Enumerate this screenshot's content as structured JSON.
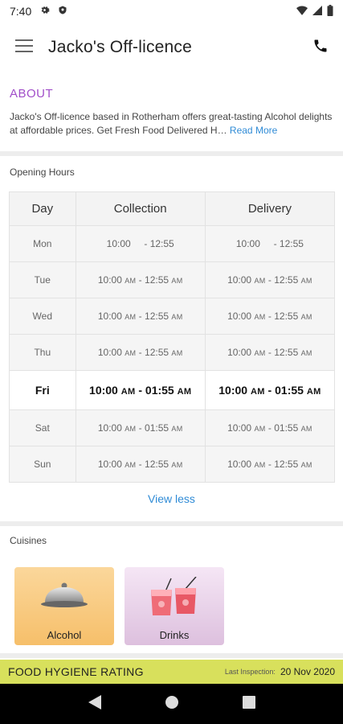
{
  "status_bar": {
    "time": "7:40",
    "icons": [
      "gear-icon",
      "shield-icon",
      "wifi-icon",
      "signal-icon",
      "battery-icon"
    ]
  },
  "app_bar": {
    "title": "Jacko's Off-licence",
    "icons": [
      "menu-icon",
      "phone-icon"
    ]
  },
  "about": {
    "heading": "ABOUT",
    "text": "Jacko's Off-licence based in Rotherham offers great-tasting Alcohol delights at affordable prices. Get Fresh Food Delivered H…",
    "read_more": "Read More"
  },
  "opening_hours": {
    "title": "Opening Hours",
    "headers": {
      "day": "Day",
      "collection": "Collection",
      "delivery": "Delivery"
    },
    "rows": [
      {
        "day": "Mon",
        "c_start": "10:00",
        "c_start_ampm": "",
        "c_end": "12:55",
        "c_end_ampm": "",
        "d_start": "10:00",
        "d_start_ampm": "",
        "d_end": "12:55",
        "d_end_ampm": ""
      },
      {
        "day": "Tue",
        "c_start": "10:00",
        "c_start_ampm": "AM",
        "c_end": "12:55",
        "c_end_ampm": "AM",
        "d_start": "10:00",
        "d_start_ampm": "AM",
        "d_end": "12:55",
        "d_end_ampm": "AM"
      },
      {
        "day": "Wed",
        "c_start": "10:00",
        "c_start_ampm": "AM",
        "c_end": "12:55",
        "c_end_ampm": "AM",
        "d_start": "10:00",
        "d_start_ampm": "AM",
        "d_end": "12:55",
        "d_end_ampm": "AM"
      },
      {
        "day": "Thu",
        "c_start": "10:00",
        "c_start_ampm": "AM",
        "c_end": "12:55",
        "c_end_ampm": "AM",
        "d_start": "10:00",
        "d_start_ampm": "AM",
        "d_end": "12:55",
        "d_end_ampm": "AM"
      },
      {
        "day": "Fri",
        "c_start": "10:00",
        "c_start_ampm": "AM",
        "c_end": "01:55",
        "c_end_ampm": "AM",
        "d_start": "10:00",
        "d_start_ampm": "AM",
        "d_end": "01:55",
        "d_end_ampm": "AM"
      },
      {
        "day": "Sat",
        "c_start": "10:00",
        "c_start_ampm": "AM",
        "c_end": "01:55",
        "c_end_ampm": "AM",
        "d_start": "10:00",
        "d_start_ampm": "AM",
        "d_end": "01:55",
        "d_end_ampm": "AM"
      },
      {
        "day": "Sun",
        "c_start": "10:00",
        "c_start_ampm": "AM",
        "c_end": "12:55",
        "c_end_ampm": "AM",
        "d_start": "10:00",
        "d_start_ampm": "AM",
        "d_end": "12:55",
        "d_end_ampm": "AM"
      }
    ],
    "view_less": "View less"
  },
  "cuisines": {
    "title": "Cuisines",
    "items": [
      {
        "label": "Alcohol",
        "icon": "cloche-icon"
      },
      {
        "label": "Drinks",
        "icon": "cocktail-glasses-icon"
      }
    ]
  },
  "food_hygiene": {
    "title": "FOOD HYGIENE RATING",
    "last_inspection_label": "Last Inspection:",
    "last_inspection_date": "20 Nov 2020"
  },
  "nav_bar": {
    "icons": [
      "back-icon",
      "home-icon",
      "recents-icon"
    ]
  },
  "colors": {
    "accent_purple": "#a14ec9",
    "link_blue": "#2f8bd6",
    "hygiene_bar": "#d8e05c"
  }
}
